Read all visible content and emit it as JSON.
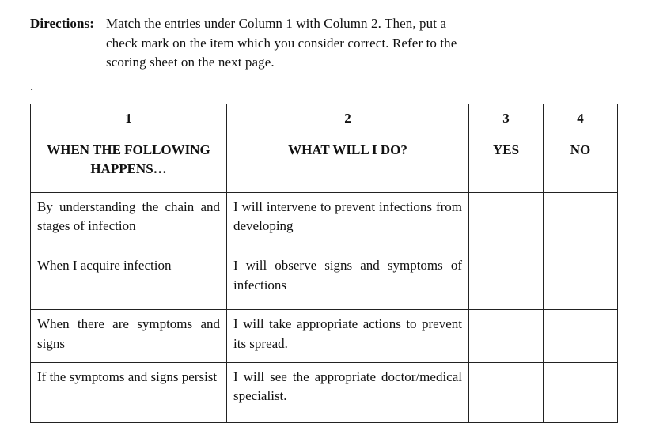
{
  "directions": {
    "label": "Directions:",
    "line1_after_label": "Match the entries under Column 1 with Column 2. Then, put a",
    "line2": "check mark on   the item which you consider correct. Refer to the",
    "line3": "scoring sheet on the next page."
  },
  "stray_dot": ".",
  "table": {
    "num_headers": {
      "c1": "1",
      "c2": "2",
      "c3": "3",
      "c4": "4"
    },
    "text_headers": {
      "c1": "WHEN THE FOLLOWING\nHAPPENS…",
      "c2": "WHAT WILL I DO?",
      "c3": "YES",
      "c4": "NO"
    },
    "rows": [
      {
        "c1": "By understanding the chain and stages of infection",
        "c2": "I will intervene to prevent infections from developing",
        "c3": "",
        "c4": ""
      },
      {
        "c1": "When I acquire infection",
        "c2": "I will observe signs and symptoms of infections",
        "c3": "",
        "c4": ""
      },
      {
        "c1": "When there are symptoms and signs",
        "c2": "I will take appropriate actions to prevent its spread.",
        "c3": "",
        "c4": ""
      },
      {
        "c1": "If the symptoms and signs persist",
        "c2": "I will see the appropriate doctor/medical specialist.",
        "c3": "",
        "c4": ""
      }
    ]
  }
}
